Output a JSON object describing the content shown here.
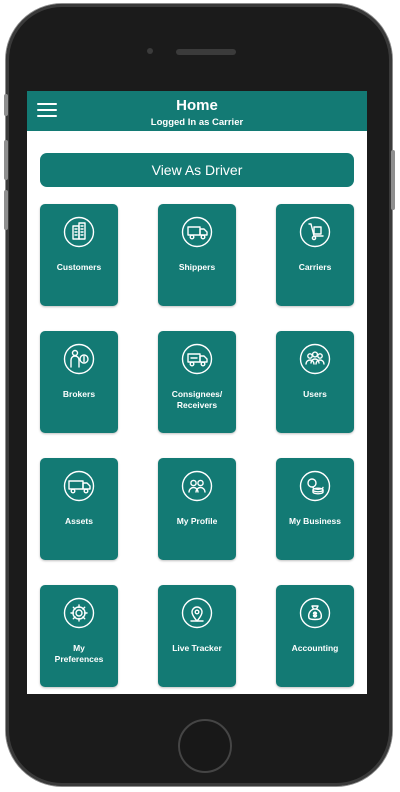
{
  "header": {
    "title": "Home",
    "subtitle": "Logged In as Carrier",
    "menu_icon": "hamburger-menu-icon"
  },
  "primary_action": {
    "label": "View As Driver"
  },
  "tiles": [
    {
      "label": "Customers",
      "icon": "building-icon"
    },
    {
      "label": "Shippers",
      "icon": "truck-icon"
    },
    {
      "label": "Carriers",
      "icon": "hand-truck-icon"
    },
    {
      "label": "Brokers",
      "icon": "broker-person-dollar-icon"
    },
    {
      "label": "Consignees/\nReceivers",
      "icon": "delivery-truck-icon"
    },
    {
      "label": "Users",
      "icon": "users-group-icon"
    },
    {
      "label": "Assets",
      "icon": "truck-side-icon"
    },
    {
      "label": "My Profile",
      "icon": "profile-users-icon"
    },
    {
      "label": "My Business",
      "icon": "coins-icon"
    },
    {
      "label": "My\nPreferences",
      "icon": "gear-icon"
    },
    {
      "label": "Live Tracker",
      "icon": "location-pin-icon"
    },
    {
      "label": "Accounting",
      "icon": "money-bag-icon"
    }
  ],
  "colors": {
    "primary": "#137a74",
    "on_primary": "#ffffff"
  }
}
